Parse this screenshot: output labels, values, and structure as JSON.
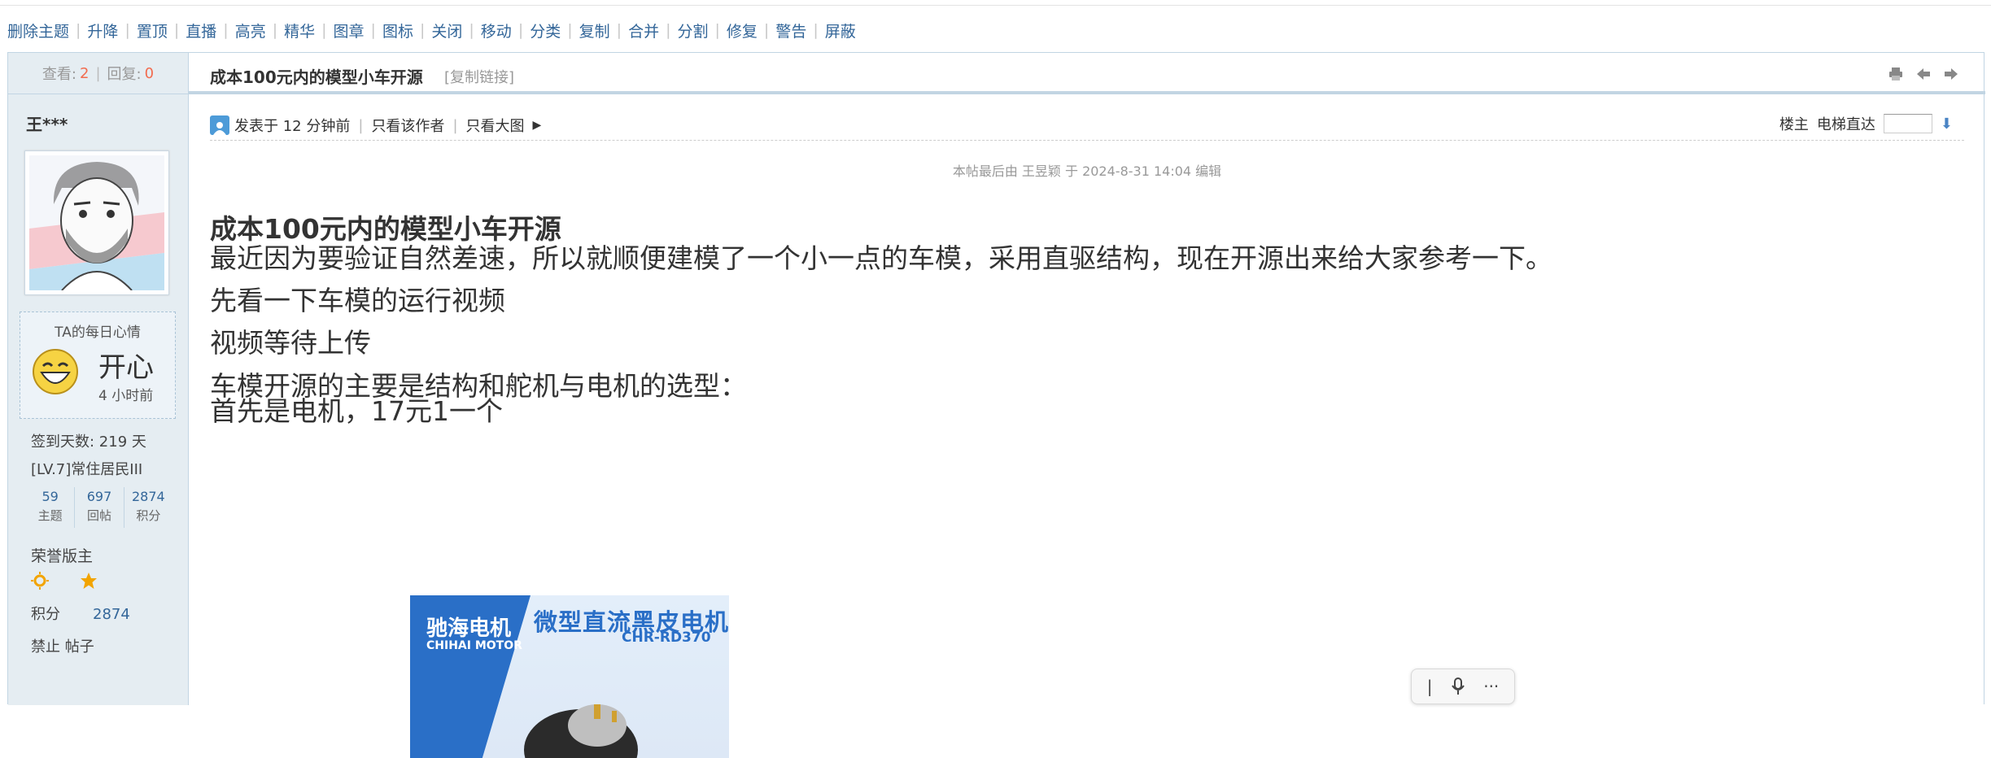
{
  "modbar": [
    "删除主题",
    "升降",
    "置顶",
    "直播",
    "高亮",
    "精华",
    "图章",
    "图标",
    "关闭",
    "移动",
    "分类",
    "复制",
    "合并",
    "分割",
    "修复",
    "警告",
    "屏蔽"
  ],
  "side": {
    "views_label": "查看:",
    "views": "2",
    "replies_label": "回复:",
    "replies": "0",
    "author": "王***",
    "mood_title": "TA的每日心情",
    "mood_word": "开心",
    "mood_time": "4 小时前",
    "signin": "签到天数: 219 天",
    "level": "[LV.7]常住居民III",
    "stats": [
      {
        "value": "59",
        "label": "主题"
      },
      {
        "value": "697",
        "label": "回帖"
      },
      {
        "value": "2874",
        "label": "积分"
      }
    ],
    "honor": "荣誉版主",
    "points_label": "积分",
    "points_value": "2874",
    "ban": "禁止 帖子"
  },
  "post": {
    "title": "成本100元内的模型小车开源",
    "copy_link": "[复制链接]",
    "posted": "发表于 12 分钟前",
    "only_author": "只看该作者",
    "big_image": "只看大图",
    "floor_label": "楼主",
    "elevator_label": "电梯直达",
    "edited": "本帖最后由 王昱颖 于 2024-8-31 14:04 编辑",
    "heading": "成本100元内的模型小车开源",
    "paragraphs": [
      "最近因为要验证自然差速，所以就顺便建模了一个小一点的车模，采用直驱结构，现在开源出来给大家参考一下。",
      "先看一下车模的运行视频",
      "视频等待上传",
      "车模开源的主要是结构和舵机与电机的选型：",
      "首先是电机，17元1一个"
    ],
    "image": {
      "brand_cn": "驰海电机",
      "brand_en": "CHIHAI MOTOR",
      "headline": "微型直流黑皮电机",
      "model": "CHR-RD370"
    }
  },
  "floatbar": {
    "cursor": "|",
    "more": "···"
  }
}
